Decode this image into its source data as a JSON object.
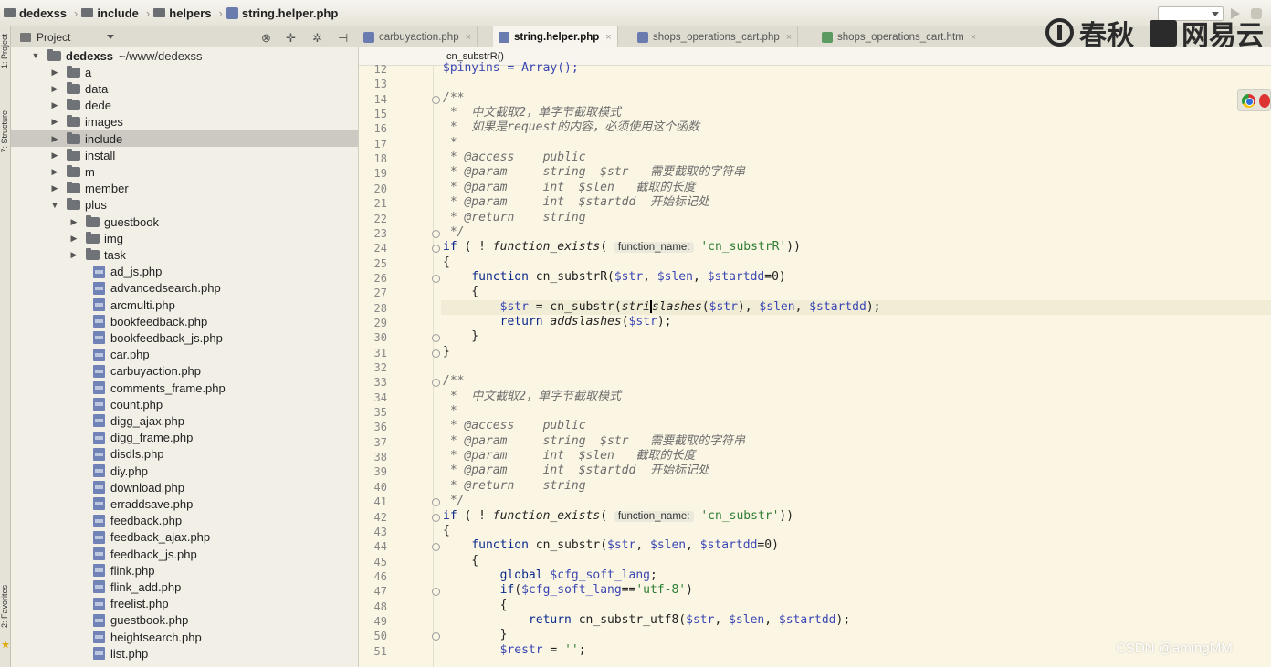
{
  "breadcrumb": [
    {
      "label": "dedexss",
      "icon": "folder-icon"
    },
    {
      "label": "include",
      "icon": "folder-icon"
    },
    {
      "label": "helpers",
      "icon": "folder-icon"
    },
    {
      "label": "string.helper.php",
      "icon": "php-file-icon"
    }
  ],
  "watermarks": {
    "logo1": "春秋",
    "logo2": "网易云",
    "csdn": "CSDN @amingMM"
  },
  "left_strip": {
    "label1": "1: Project",
    "label2": "7: Structure",
    "label3": "2: Favorites"
  },
  "project_panel": {
    "label": "Project",
    "icons": [
      "target-icon",
      "gear-icon",
      "collapse-icon"
    ]
  },
  "tabs": [
    {
      "label": "carbuyaction.php",
      "icon": "php-file-icon",
      "active": false
    },
    {
      "label": "string.helper.php",
      "icon": "php-file-icon",
      "active": true
    },
    {
      "label": "shops_operations_cart.php",
      "icon": "php-file-icon",
      "active": false
    },
    {
      "label": "shops_operations_cart.htm",
      "icon": "htm-file-icon",
      "active": false
    }
  ],
  "tab_close": "×",
  "editor_breadcrumb": "cn_substrR()",
  "tree": [
    {
      "label": "dedexss",
      "suffix": "~/www/dedexss",
      "type": "folder",
      "level": 0,
      "expanded": true
    },
    {
      "label": "a",
      "type": "folder",
      "level": 1,
      "expanded": false
    },
    {
      "label": "data",
      "type": "folder",
      "level": 1,
      "expanded": false
    },
    {
      "label": "dede",
      "type": "folder",
      "level": 1,
      "expanded": false
    },
    {
      "label": "images",
      "type": "folder",
      "level": 1,
      "expanded": false
    },
    {
      "label": "include",
      "type": "folder",
      "level": 1,
      "expanded": false,
      "selected": true
    },
    {
      "label": "install",
      "type": "folder",
      "level": 1,
      "expanded": false
    },
    {
      "label": "m",
      "type": "folder",
      "level": 1,
      "expanded": false
    },
    {
      "label": "member",
      "type": "folder",
      "level": 1,
      "expanded": false
    },
    {
      "label": "plus",
      "type": "folder",
      "level": 1,
      "expanded": true
    },
    {
      "label": "guestbook",
      "type": "folder",
      "level": 2,
      "expanded": false
    },
    {
      "label": "img",
      "type": "folder",
      "level": 2,
      "expanded": false
    },
    {
      "label": "task",
      "type": "folder",
      "level": 2,
      "expanded": false
    },
    {
      "label": "ad_js.php",
      "type": "file",
      "level": 2
    },
    {
      "label": "advancedsearch.php",
      "type": "file",
      "level": 2
    },
    {
      "label": "arcmulti.php",
      "type": "file",
      "level": 2
    },
    {
      "label": "bookfeedback.php",
      "type": "file",
      "level": 2
    },
    {
      "label": "bookfeedback_js.php",
      "type": "file",
      "level": 2
    },
    {
      "label": "car.php",
      "type": "file",
      "level": 2
    },
    {
      "label": "carbuyaction.php",
      "type": "file",
      "level": 2
    },
    {
      "label": "comments_frame.php",
      "type": "file",
      "level": 2
    },
    {
      "label": "count.php",
      "type": "file",
      "level": 2
    },
    {
      "label": "digg_ajax.php",
      "type": "file",
      "level": 2
    },
    {
      "label": "digg_frame.php",
      "type": "file",
      "level": 2
    },
    {
      "label": "disdls.php",
      "type": "file",
      "level": 2
    },
    {
      "label": "diy.php",
      "type": "file",
      "level": 2
    },
    {
      "label": "download.php",
      "type": "file",
      "level": 2
    },
    {
      "label": "erraddsave.php",
      "type": "file",
      "level": 2
    },
    {
      "label": "feedback.php",
      "type": "file",
      "level": 2
    },
    {
      "label": "feedback_ajax.php",
      "type": "file",
      "level": 2
    },
    {
      "label": "feedback_js.php",
      "type": "file",
      "level": 2
    },
    {
      "label": "flink.php",
      "type": "file",
      "level": 2
    },
    {
      "label": "flink_add.php",
      "type": "file",
      "level": 2
    },
    {
      "label": "freelist.php",
      "type": "file",
      "level": 2
    },
    {
      "label": "guestbook.php",
      "type": "file",
      "level": 2
    },
    {
      "label": "heightsearch.php",
      "type": "file",
      "level": 2
    },
    {
      "label": "list.php",
      "type": "file",
      "level": 2
    }
  ],
  "code_lines": [
    {
      "n": "12",
      "f": false,
      "t": [
        [
          "$pinyins = Array();",
          "vr"
        ]
      ]
    },
    {
      "n": "13",
      "f": false,
      "t": []
    },
    {
      "n": "14",
      "f": true,
      "t": [
        [
          "/**",
          "cm"
        ]
      ]
    },
    {
      "n": "15",
      "f": false,
      "t": [
        [
          " *  中文截取2，单字节截取模式",
          "cm"
        ]
      ]
    },
    {
      "n": "16",
      "f": false,
      "t": [
        [
          " *  如果是request的内容，必须使用这个函数",
          "cm"
        ]
      ]
    },
    {
      "n": "17",
      "f": false,
      "t": [
        [
          " *",
          "cm"
        ]
      ]
    },
    {
      "n": "18",
      "f": false,
      "t": [
        [
          " * @access    public",
          "cm"
        ]
      ]
    },
    {
      "n": "19",
      "f": false,
      "t": [
        [
          " * @param     string  $str   需要截取的字符串",
          "cm"
        ]
      ]
    },
    {
      "n": "20",
      "f": false,
      "t": [
        [
          " * @param     int  $slen   截取的长度",
          "cm"
        ]
      ]
    },
    {
      "n": "21",
      "f": false,
      "t": [
        [
          " * @param     int  $startdd  开始标记处",
          "cm"
        ]
      ]
    },
    {
      "n": "22",
      "f": false,
      "t": [
        [
          " * @return    string",
          "cm"
        ]
      ]
    },
    {
      "n": "23",
      "f": true,
      "t": [
        [
          " */",
          "cm"
        ]
      ]
    },
    {
      "n": "24",
      "f": true,
      "t": [
        [
          "if",
          "kw"
        ],
        [
          " ( ! ",
          ""
        ],
        [
          "function_exists",
          "it"
        ],
        [
          "( ",
          ""
        ],
        [
          "function_name:",
          "hint"
        ],
        [
          " ",
          ""
        ],
        [
          "'cn_substrR'",
          "st"
        ],
        [
          "))",
          ""
        ]
      ]
    },
    {
      "n": "25",
      "f": false,
      "t": [
        [
          "{",
          ""
        ]
      ]
    },
    {
      "n": "26",
      "f": true,
      "t": [
        [
          "    ",
          ""
        ],
        [
          "function",
          "kw"
        ],
        [
          " cn_substrR(",
          ""
        ],
        [
          "$str",
          "vr"
        ],
        [
          ", ",
          ""
        ],
        [
          "$slen",
          "vr"
        ],
        [
          ", ",
          ""
        ],
        [
          "$startdd",
          "vr"
        ],
        [
          "=0)",
          ""
        ]
      ]
    },
    {
      "n": "27",
      "f": false,
      "t": [
        [
          "    {",
          ""
        ]
      ]
    },
    {
      "n": "28",
      "f": false,
      "cur": true,
      "t": [
        [
          "        ",
          ""
        ],
        [
          "$str",
          "vr"
        ],
        [
          " = cn_substr(",
          ""
        ],
        [
          "stri",
          "it"
        ],
        [
          "|",
          "cursor"
        ],
        [
          "slashes",
          "it"
        ],
        [
          "(",
          ""
        ],
        [
          "$str",
          "vr"
        ],
        [
          "), ",
          ""
        ],
        [
          "$slen",
          "vr"
        ],
        [
          ", ",
          ""
        ],
        [
          "$startdd",
          "vr"
        ],
        [
          ");",
          ""
        ]
      ]
    },
    {
      "n": "29",
      "f": false,
      "t": [
        [
          "        ",
          ""
        ],
        [
          "return",
          "kw"
        ],
        [
          " ",
          ""
        ],
        [
          "addslashes",
          "it"
        ],
        [
          "(",
          ""
        ],
        [
          "$str",
          "vr"
        ],
        [
          ");",
          ""
        ]
      ]
    },
    {
      "n": "30",
      "f": true,
      "t": [
        [
          "    }",
          ""
        ]
      ]
    },
    {
      "n": "31",
      "f": true,
      "t": [
        [
          "}",
          ""
        ]
      ]
    },
    {
      "n": "32",
      "f": false,
      "t": []
    },
    {
      "n": "33",
      "f": true,
      "t": [
        [
          "/**",
          "cm"
        ]
      ]
    },
    {
      "n": "34",
      "f": false,
      "t": [
        [
          " *  中文截取2，单字节截取模式",
          "cm"
        ]
      ]
    },
    {
      "n": "35",
      "f": false,
      "t": [
        [
          " *",
          "cm"
        ]
      ]
    },
    {
      "n": "36",
      "f": false,
      "t": [
        [
          " * @access    public",
          "cm"
        ]
      ]
    },
    {
      "n": "37",
      "f": false,
      "t": [
        [
          " * @param     string  $str   需要截取的字符串",
          "cm"
        ]
      ]
    },
    {
      "n": "38",
      "f": false,
      "t": [
        [
          " * @param     int  $slen   截取的长度",
          "cm"
        ]
      ]
    },
    {
      "n": "39",
      "f": false,
      "t": [
        [
          " * @param     int  $startdd  开始标记处",
          "cm"
        ]
      ]
    },
    {
      "n": "40",
      "f": false,
      "t": [
        [
          " * @return    string",
          "cm"
        ]
      ]
    },
    {
      "n": "41",
      "f": true,
      "t": [
        [
          " */",
          "cm"
        ]
      ]
    },
    {
      "n": "42",
      "f": true,
      "t": [
        [
          "if",
          "kw"
        ],
        [
          " ( ! ",
          ""
        ],
        [
          "function_exists",
          "it"
        ],
        [
          "( ",
          ""
        ],
        [
          "function_name:",
          "hint"
        ],
        [
          " ",
          ""
        ],
        [
          "'cn_substr'",
          "st"
        ],
        [
          "))",
          ""
        ]
      ]
    },
    {
      "n": "43",
      "f": false,
      "t": [
        [
          "{",
          ""
        ]
      ]
    },
    {
      "n": "44",
      "f": true,
      "t": [
        [
          "    ",
          ""
        ],
        [
          "function",
          "kw"
        ],
        [
          " cn_substr(",
          ""
        ],
        [
          "$str",
          "vr"
        ],
        [
          ", ",
          ""
        ],
        [
          "$slen",
          "vr"
        ],
        [
          ", ",
          ""
        ],
        [
          "$startdd",
          "vr"
        ],
        [
          "=0)",
          ""
        ]
      ]
    },
    {
      "n": "45",
      "f": false,
      "t": [
        [
          "    {",
          ""
        ]
      ]
    },
    {
      "n": "46",
      "f": false,
      "t": [
        [
          "        ",
          ""
        ],
        [
          "global",
          "kw"
        ],
        [
          " ",
          ""
        ],
        [
          "$cfg_soft_lang",
          "vr"
        ],
        [
          ";",
          ""
        ]
      ]
    },
    {
      "n": "47",
      "f": true,
      "t": [
        [
          "        ",
          ""
        ],
        [
          "if",
          "kw"
        ],
        [
          "(",
          ""
        ],
        [
          "$cfg_soft_lang",
          "vr"
        ],
        [
          "==",
          ""
        ],
        [
          "'utf-8'",
          "st"
        ],
        [
          ")",
          ""
        ]
      ]
    },
    {
      "n": "48",
      "f": false,
      "t": [
        [
          "        {",
          ""
        ]
      ]
    },
    {
      "n": "49",
      "f": false,
      "t": [
        [
          "            ",
          ""
        ],
        [
          "return",
          "kw"
        ],
        [
          " cn_substr_utf8(",
          ""
        ],
        [
          "$str",
          "vr"
        ],
        [
          ", ",
          ""
        ],
        [
          "$slen",
          "vr"
        ],
        [
          ", ",
          ""
        ],
        [
          "$startdd",
          "vr"
        ],
        [
          ");",
          ""
        ]
      ]
    },
    {
      "n": "50",
      "f": true,
      "t": [
        [
          "        }",
          ""
        ]
      ]
    },
    {
      "n": "51",
      "f": false,
      "t": [
        [
          "        ",
          ""
        ],
        [
          "$restr",
          "vr"
        ],
        [
          " = ",
          ""
        ],
        [
          "''",
          "st"
        ],
        [
          ";",
          ""
        ]
      ]
    }
  ]
}
